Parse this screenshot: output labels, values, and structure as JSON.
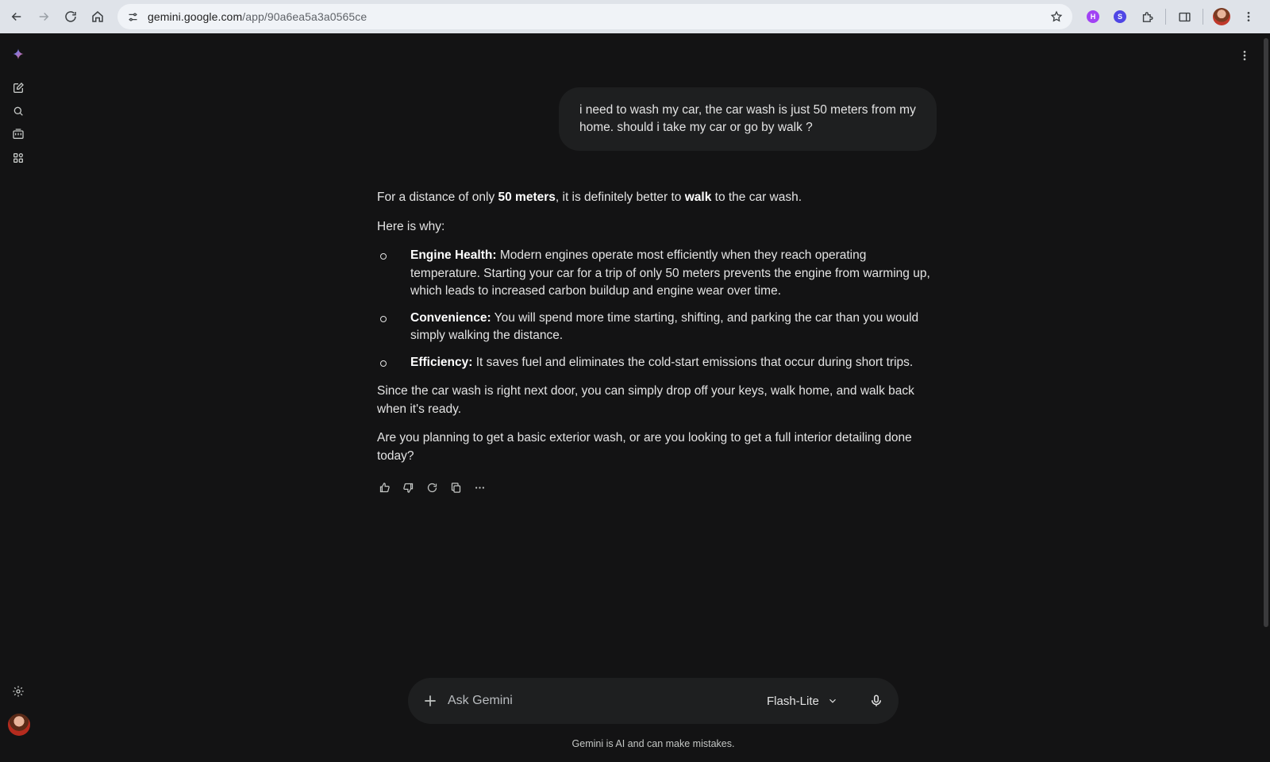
{
  "browser": {
    "url_domain": "gemini.google.com",
    "url_path": "/app/90a6ea5a3a0565ce",
    "extensions": [
      {
        "name": "extension-purple",
        "color": "#a142f4",
        "glyph": "H"
      },
      {
        "name": "extension-blue",
        "color": "#4f46e5",
        "glyph": "S"
      }
    ]
  },
  "conversation": {
    "user_message": "i need to wash my car, the car wash is just 50 meters from my home. should i take my car or go by walk ?",
    "answer": {
      "intro_pre": "For a distance of only ",
      "intro_bold1": "50 meters",
      "intro_mid": ", it is definitely better to ",
      "intro_bold2": "walk",
      "intro_post": " to the car wash.",
      "why": "Here is why:",
      "bullets": [
        {
          "title": "Engine Health:",
          "text": " Modern engines operate most efficiently when they reach operating temperature. Starting your car for a trip of only 50 meters prevents the engine from warming up, which leads to increased carbon buildup and engine wear over time."
        },
        {
          "title": "Convenience:",
          "text": " You will spend more time starting, shifting, and parking the car than you would simply walking the distance."
        },
        {
          "title": "Efficiency:",
          "text": " It saves fuel and eliminates the cold-start emissions that occur during short trips."
        }
      ],
      "para2": "Since the car wash is right next door, you can simply drop off your keys, walk home, and walk back when it's ready.",
      "para3": "Are you planning to get a basic exterior wash, or are you looking to get a full interior detailing done today?"
    }
  },
  "composer": {
    "placeholder": "Ask Gemini",
    "model": "Flash-Lite"
  },
  "disclaimer": "Gemini is AI and can make mistakes.",
  "colors": {
    "background": "#131314",
    "surface": "#1e1f20",
    "text": "#e3e3e3"
  }
}
